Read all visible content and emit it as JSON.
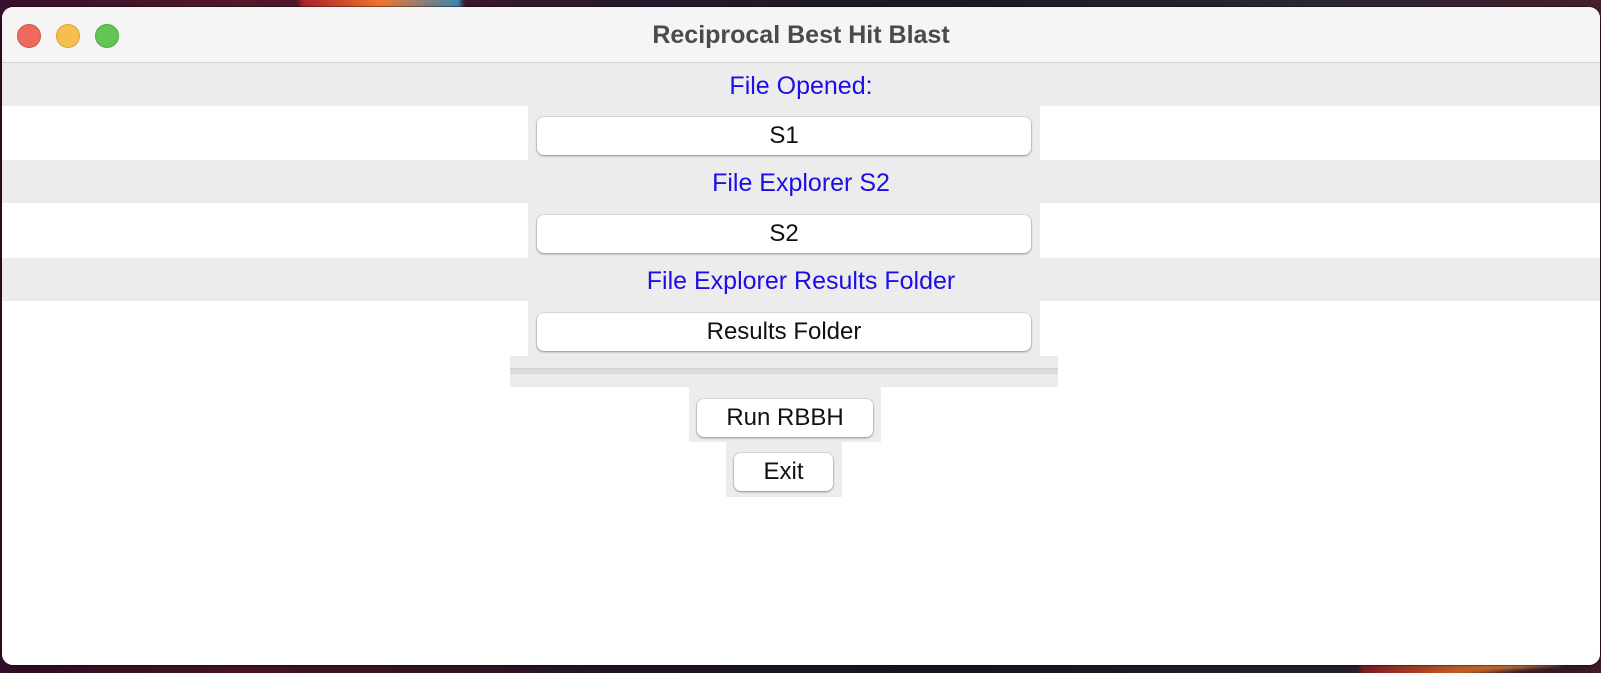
{
  "window": {
    "title": "Reciprocal Best Hit Blast"
  },
  "sections": [
    {
      "label": "File Opened:",
      "button": "S1"
    },
    {
      "label": "File Explorer S2",
      "button": "S2"
    },
    {
      "label": "File Explorer Results Folder",
      "button": "Results Folder"
    }
  ],
  "actions": {
    "run_label": "Run RBBH",
    "exit_label": "Exit"
  },
  "colors": {
    "label_text": "#1d0ee6",
    "band_background": "#ececec"
  }
}
